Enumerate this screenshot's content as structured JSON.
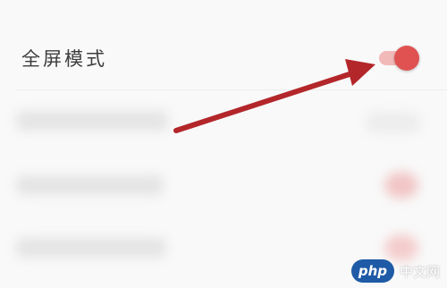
{
  "settings": {
    "fullscreen_label": "全屏模式",
    "fullscreen_enabled": true
  },
  "colors": {
    "accent": "#e05252",
    "accent_light": "#f2b9b9",
    "arrow": "#b3262a",
    "background": "#f9f9f9"
  },
  "watermark": {
    "logo": "php",
    "text": "中文网"
  }
}
